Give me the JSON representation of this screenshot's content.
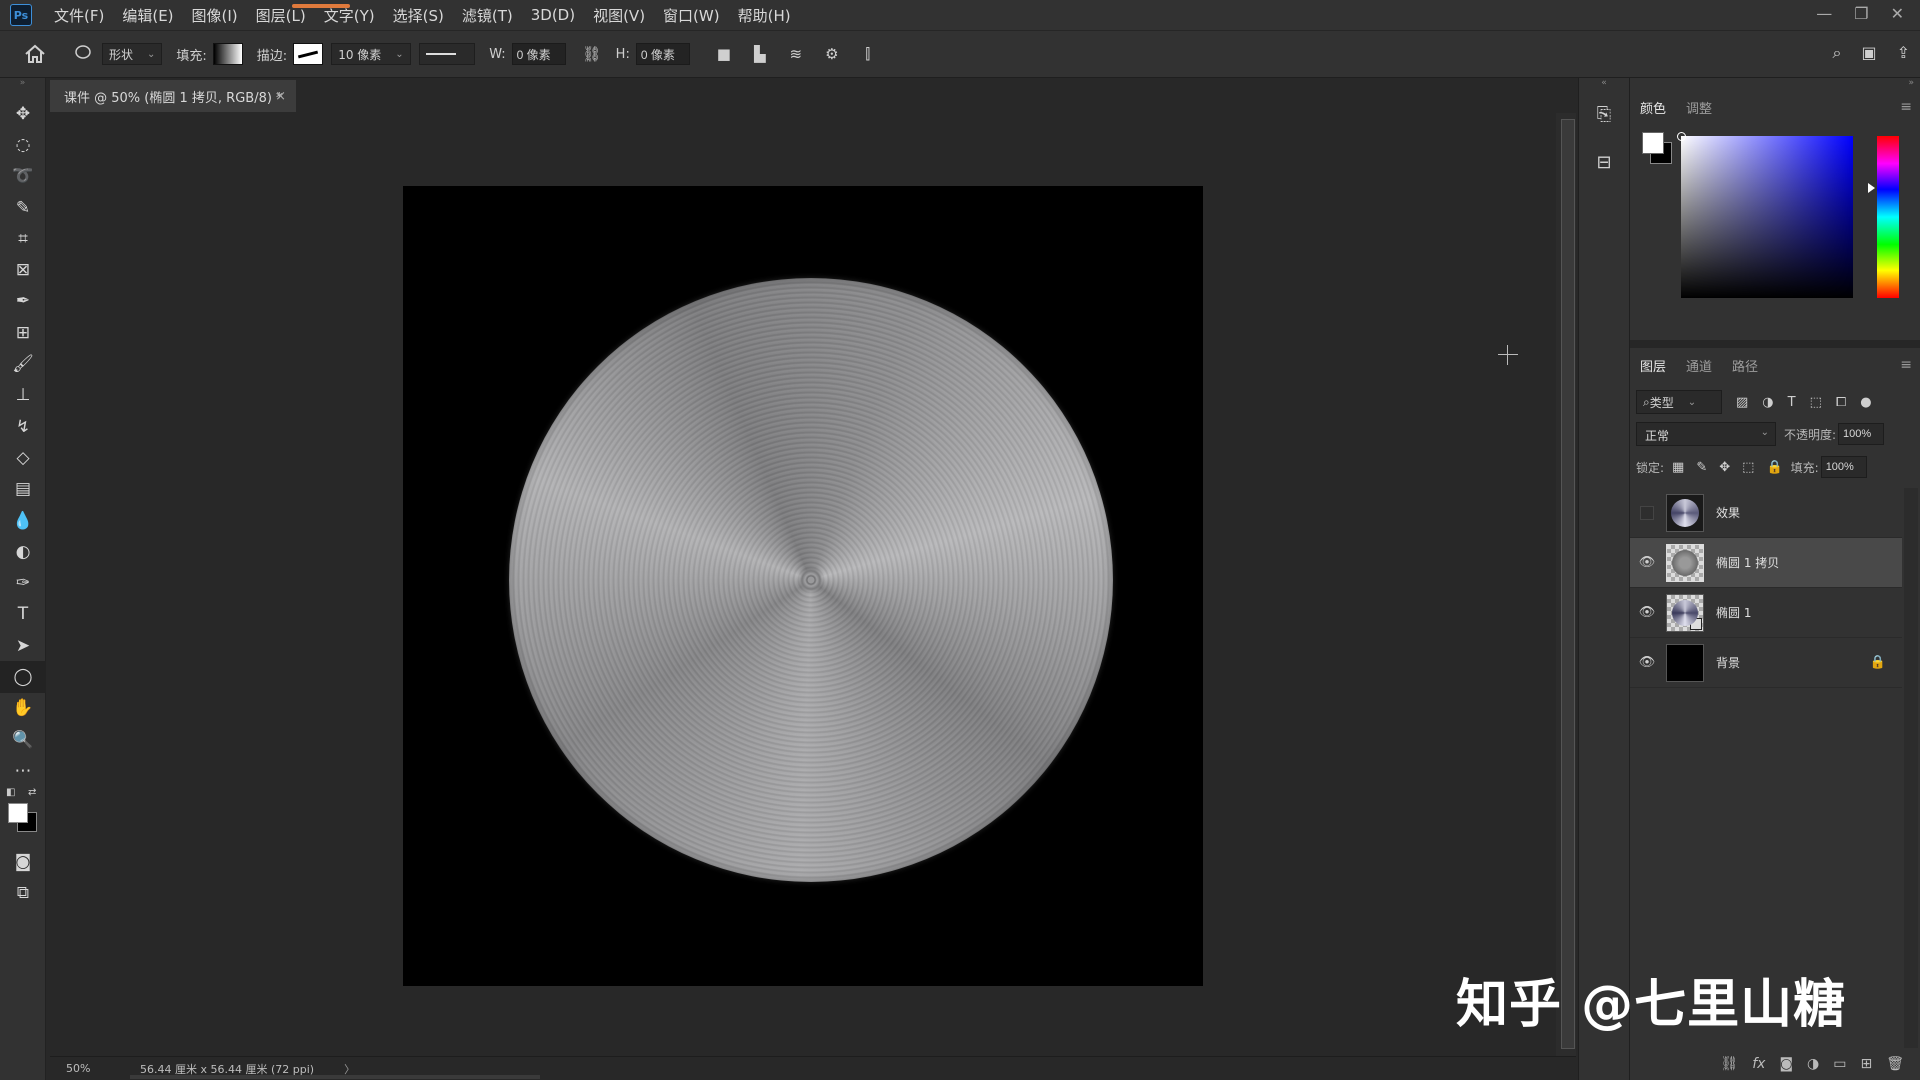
{
  "app": {
    "logo": "Ps",
    "menus": [
      "文件(F)",
      "编辑(E)",
      "图像(I)",
      "图层(L)",
      "文字(Y)",
      "选择(S)",
      "滤镜(T)",
      "3D(D)",
      "视图(V)",
      "窗口(W)",
      "帮助(H)"
    ],
    "window_controls": [
      "—",
      "❐",
      "✕"
    ]
  },
  "options": {
    "shape_mode": "形状",
    "fill_label": "填充:",
    "stroke_label": "描边:",
    "stroke_width": "10 像素",
    "w_label": "W:",
    "w_value": "0 像素",
    "h_label": "H:",
    "h_value": "0 像素"
  },
  "document": {
    "tab_title": "课件 @ 50% (椭圆 1 拷贝, RGB/8) *",
    "close": "×",
    "zoom": "50%",
    "size_info": "56.44 厘米 x 56.44 厘米 (72 ppi)",
    "status_arrow": "〉"
  },
  "color_panel": {
    "tabs": [
      "颜色",
      "调整"
    ],
    "menu": "≡"
  },
  "layers_panel": {
    "tabs": [
      "图层",
      "通道",
      "路径"
    ],
    "filter_label": "类型",
    "blend_mode": "正常",
    "opacity_label": "不透明度:",
    "opacity_value": "100%",
    "lock_label": "锁定:",
    "fill_label": "填充:",
    "fill_value": "100%",
    "layers": [
      {
        "name": "效果",
        "visible": false
      },
      {
        "name": "椭圆 1 拷贝",
        "visible": true,
        "selected": true
      },
      {
        "name": "椭圆 1",
        "visible": true
      },
      {
        "name": "背景",
        "visible": true,
        "locked": true
      }
    ]
  },
  "watermark": "知乎 @七里山糖"
}
